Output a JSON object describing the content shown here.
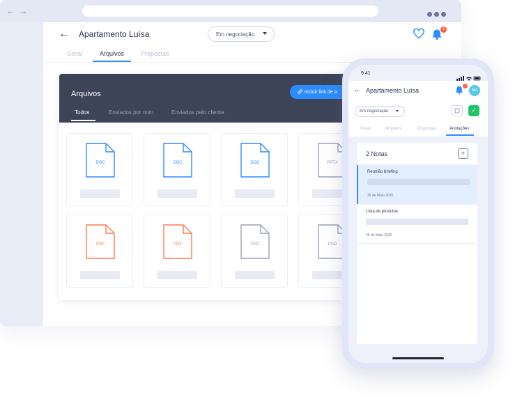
{
  "desktop": {
    "title": "Apartamento Luísa",
    "status": "Em negociação",
    "notif_count": "1",
    "tabs": [
      "Geral",
      "Arquivos",
      "Propostas"
    ],
    "panel": {
      "title": "Arquivos",
      "add_link": "Incluir link de a",
      "filter_tabs": [
        "Todos",
        "Enviados por mim",
        "Enviados pelo cliente"
      ]
    },
    "files": [
      {
        "type": "DOC",
        "color": "#2d8cff"
      },
      {
        "type": "DOC",
        "color": "#2d8cff"
      },
      {
        "type": "DOC",
        "color": "#2d8cff"
      },
      {
        "type": "PPTX",
        "color": "#9aa0b8"
      },
      {
        "type": "PDF",
        "color": "#ff7a4a"
      },
      {
        "type": "PDF",
        "color": "#ff7a4a"
      },
      {
        "type": "PSD",
        "color": "#9aa0b8"
      },
      {
        "type": "PSD",
        "color": "#9aa0b8"
      }
    ]
  },
  "mobile": {
    "time": "9:41",
    "title": "Apartamento Luísa",
    "notif_count": "1",
    "avatar": "MA",
    "status": "Em negociação",
    "tabs": [
      "Geral",
      "Arquivos",
      "Propostas",
      "Anotações"
    ],
    "notes_header": "2 Notas",
    "add": "+",
    "notes": [
      {
        "title": "Reunião briefing",
        "date": "26 de Maio 2020"
      },
      {
        "title": "Lista de produtos",
        "date": "25 de Maio 2020"
      }
    ]
  },
  "colors": {
    "accent": "#2d8cff",
    "panel_header": "#3d4458",
    "success": "#22c36a",
    "badge": "#ff5b3c"
  }
}
